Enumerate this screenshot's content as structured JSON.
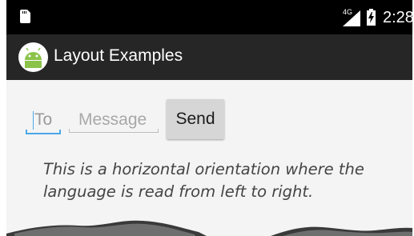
{
  "status_bar": {
    "network_type": "4G",
    "time": "2:28",
    "icons": [
      "sim-card-icon",
      "signal-icon",
      "battery-charging-icon"
    ]
  },
  "app_bar": {
    "title": "Layout Examples",
    "icon": "android-icon"
  },
  "form": {
    "to_placeholder": "To",
    "message_placeholder": "Message",
    "send_label": "Send"
  },
  "description": {
    "line1": "This is a horizontal orientation where the",
    "line2": "language is read from left to right."
  },
  "colors": {
    "status_bar": "#000000",
    "app_bar": "#262626",
    "background": "#f4f4f4",
    "focus_accent": "#4aa8e8",
    "button": "#d6d6d6",
    "android_green": "#8bc34a"
  }
}
